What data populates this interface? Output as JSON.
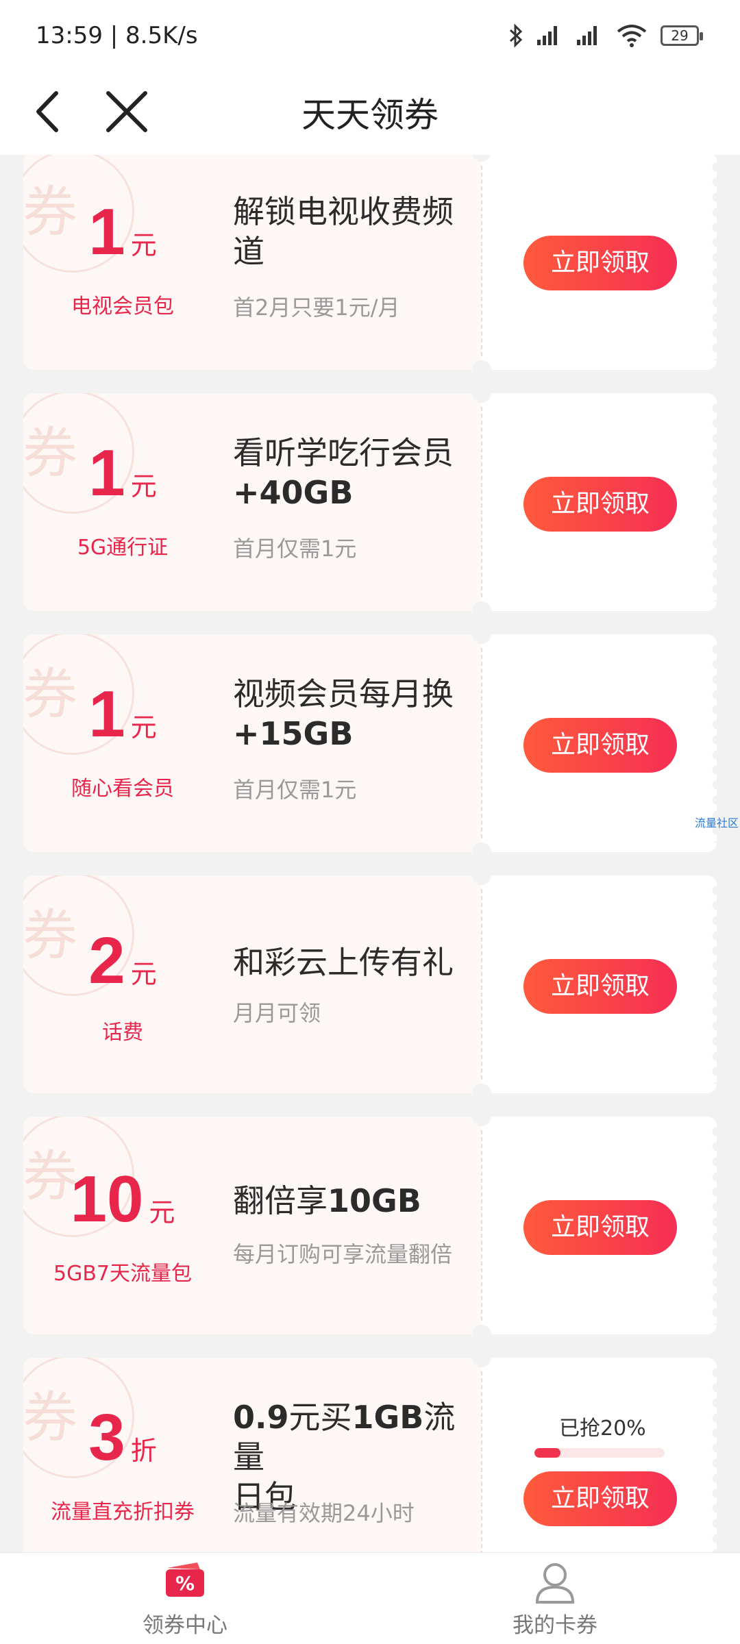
{
  "status": {
    "time": "13:59 | 8.5K/s",
    "battery": "29"
  },
  "nav": {
    "title": "天天领券"
  },
  "watermark": "券",
  "coupons": [
    {
      "amount": "1",
      "unit": "元",
      "label": "电视会员包",
      "title_parts": [
        "解锁电视收费频",
        "道"
      ],
      "subtitle": "首2月只要1元/月",
      "button": "立即领取"
    },
    {
      "amount": "1",
      "unit": "元",
      "label": "5G通行证",
      "title_line1": "看听学吃行会员",
      "title_line2": "+40GB",
      "subtitle": "首月仅需1元",
      "button": "立即领取"
    },
    {
      "amount": "1",
      "unit": "元",
      "label": "随心看会员",
      "title_line1": "视频会员每月换",
      "title_line2": "+15GB",
      "subtitle": "首月仅需1元",
      "button": "立即领取"
    },
    {
      "amount": "2",
      "unit": "元",
      "label": "话费",
      "title_line1": "和彩云上传有礼",
      "subtitle": "月月可领",
      "button": "立即领取"
    },
    {
      "amount": "10",
      "unit": "元",
      "label": "5GB7天流量包",
      "title_line1_a": "翻倍享",
      "title_line1_b": "10GB",
      "subtitle": "每月订购可享流量翻倍",
      "button": "立即领取"
    },
    {
      "amount": "3",
      "unit": "折",
      "label": "流量直充折扣券",
      "title_a": "0.9",
      "title_b": "元买",
      "title_c": "1GB",
      "title_d": "流量",
      "title_line2": "日包",
      "subtitle": "流量有效期24小时",
      "progress_label": "已抢20%",
      "progress": 0.2,
      "button": "立即领取"
    }
  ],
  "side_tag": "流量社区",
  "tabs": [
    {
      "label": "领券中心"
    },
    {
      "label": "我的卡券"
    }
  ],
  "colors": {
    "accent": "#e8254a",
    "button": "#f5443f"
  }
}
